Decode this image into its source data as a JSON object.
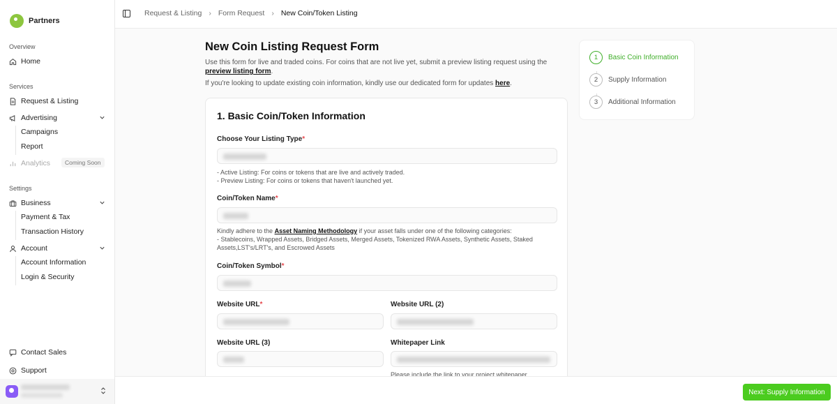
{
  "brand": {
    "name": "Partners"
  },
  "sidebar": {
    "sections": {
      "overview": "Overview",
      "services": "Services",
      "settings": "Settings"
    },
    "home": "Home",
    "request_listing": "Request & Listing",
    "advertising": "Advertising",
    "campaigns": "Campaigns",
    "report": "Report",
    "analytics": "Analytics",
    "coming_soon": "Coming Soon",
    "business": "Business",
    "payment_tax": "Payment & Tax",
    "transaction_history": "Transaction History",
    "account": "Account",
    "account_information": "Account Information",
    "login_security": "Login & Security",
    "contact_sales": "Contact Sales",
    "support": "Support"
  },
  "breadcrumb": [
    "Request & Listing",
    "Form Request",
    "New Coin/Token Listing"
  ],
  "page": {
    "title": "New Coin Listing Request Form",
    "intro_text": "Use this form for live and traded coins. For coins that are not live yet, submit a preview listing request using the",
    "intro_link": "preview listing form",
    "intro_end": ".",
    "update_text": "If you're looking to update existing coin information, kindly use our dedicated form for updates",
    "update_link": "here",
    "update_end": "."
  },
  "form": {
    "section_title": "1. Basic Coin/Token Information",
    "listing_type_label": "Choose Your Listing Type",
    "listing_help_1": "- Active Listing: For coins or tokens that are live and actively traded.",
    "listing_help_2": "- Preview Listing: For coins or tokens that haven't launched yet.",
    "name_label": "Coin/Token Name",
    "name_help_pre": "Kindly adhere to the",
    "name_help_link": "Asset Naming Methodology",
    "name_help_post": "if your asset falls under one of the following categories:",
    "name_help_2": "- Stablecoins, Wrapped Assets, Bridged Assets, Merged Assets, Tokenized RWA Assets, Synthetic Assets, Staked Assets,LST's/LRT's, and Escrowed Assets",
    "symbol_label": "Coin/Token Symbol",
    "website_label": "Website URL",
    "website2_label": "Website URL (2)",
    "website3_label": "Website URL (3)",
    "whitepaper_label": "Whitepaper Link",
    "whitepaper_help": "Please include the link to your project whitepaper",
    "required_mark": "*"
  },
  "steps": [
    {
      "num": "1",
      "label": "Basic Coin Information"
    },
    {
      "num": "2",
      "label": "Supply Information"
    },
    {
      "num": "3",
      "label": "Additional Information"
    }
  ],
  "footer": {
    "next_label": "Next: Supply Information"
  },
  "icons": {
    "home": "home-icon",
    "request": "document-icon",
    "advertising": "megaphone-icon",
    "analytics": "bar-chart-icon",
    "business": "briefcase-icon",
    "account": "user-icon",
    "contact": "chat-icon",
    "support": "help-circle-icon"
  },
  "colors": {
    "accent": "#4bcc1f",
    "step_active": "#3fae29",
    "required": "#e5484d"
  }
}
